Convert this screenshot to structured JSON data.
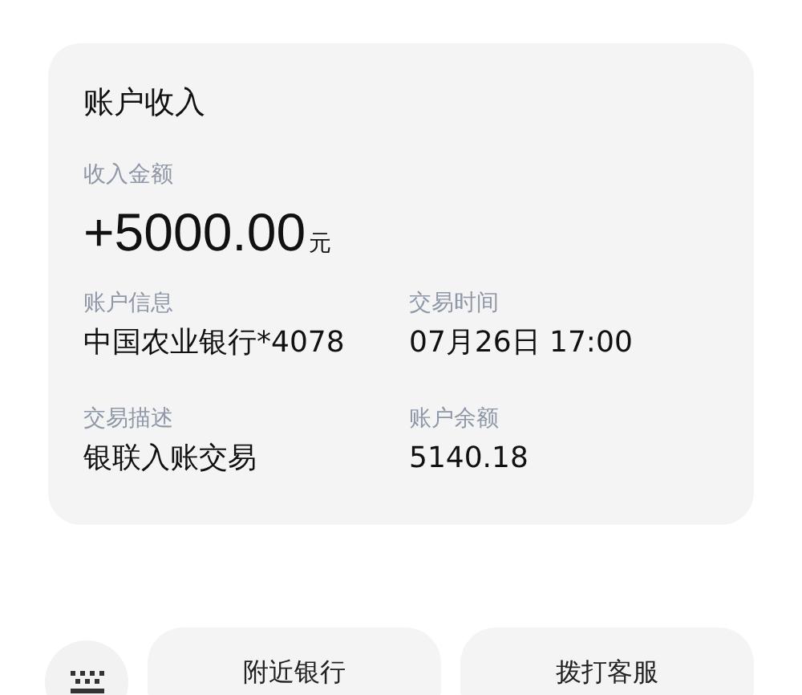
{
  "card": {
    "title": "账户收入",
    "amount_label": "收入金额",
    "amount": "+5000.00",
    "currency": "元",
    "fields": [
      {
        "label": "账户信息",
        "value": "中国农业银行*4078"
      },
      {
        "label": "交易时间",
        "value": "07月26日 17:00"
      },
      {
        "label": "交易描述",
        "value": "银联入账交易"
      },
      {
        "label": "账户余额",
        "value": "5140.18"
      }
    ]
  },
  "actions": [
    "附近银行",
    "拨打客服"
  ]
}
